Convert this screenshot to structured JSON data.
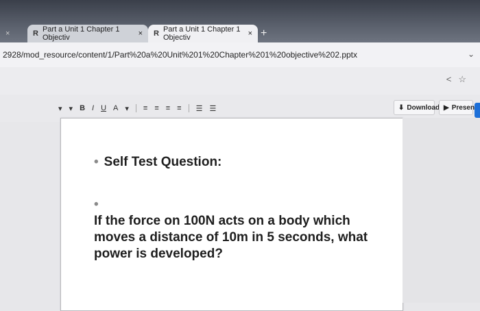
{
  "tabs": [
    {
      "label": "Part a Unit 1 Chapter 1 Objectiv",
      "close": "×"
    },
    {
      "label": "Part a Unit 1 Chapter 1 Objectiv",
      "close": "×"
    }
  ],
  "first_tab_close": "×",
  "new_tab": "+",
  "address": {
    "url": "2928/mod_resource/content/1/Part%20a%20Unit%201%20Chapter%201%20objective%202.pptx"
  },
  "ppt_toolbar": {
    "download_label": "Download",
    "present_label": "Present",
    "format_buttons": [
      "B",
      "I",
      "U",
      "A"
    ]
  },
  "slide": {
    "bullet1": "Self Test Question:",
    "bullet2": "If the force on 100N acts on a body which moves a distance of 10m in 5 seconds, what power is developed?"
  },
  "icons": {
    "tab_favicon": "R",
    "share": "<",
    "star": "☆",
    "download_icon": "⬇",
    "present_icon": "▶"
  },
  "colors": {
    "accent": "#1d6fd8"
  }
}
